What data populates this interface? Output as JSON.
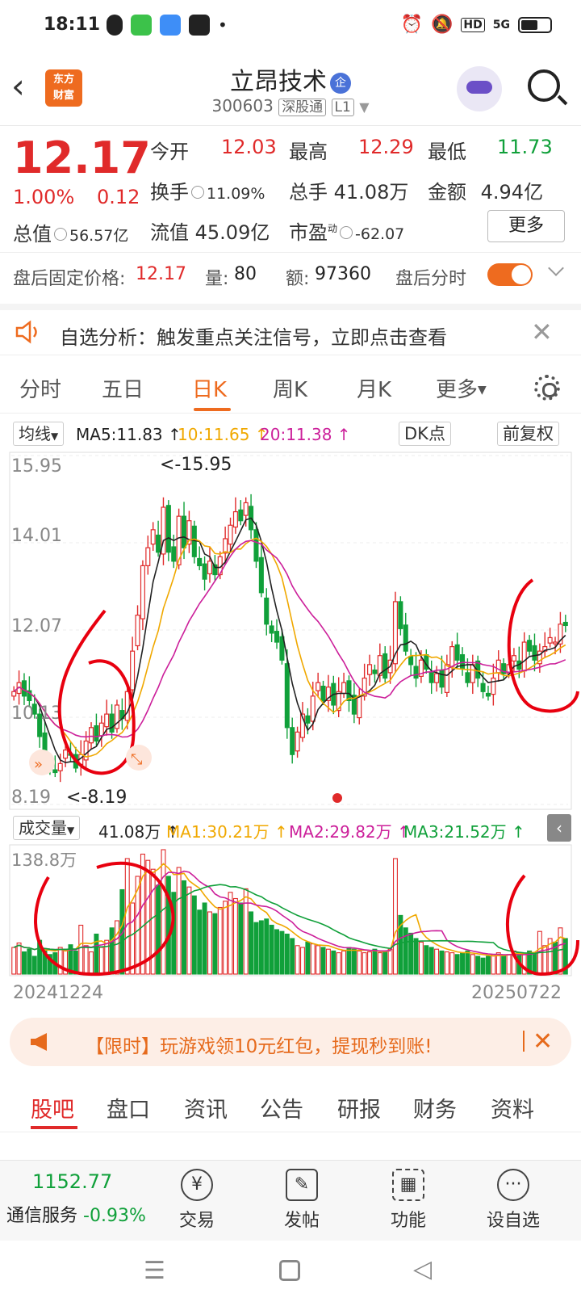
{
  "status": {
    "time": "18:11",
    "net_label": "HD",
    "signal_label": "5G"
  },
  "header": {
    "name": "立昂技术",
    "qi_badge": "企",
    "code": "300603",
    "tag1": "深股通",
    "tag2": "L1",
    "logo_line1": "东方",
    "logo_line2": "财富"
  },
  "quote": {
    "price": "12.17",
    "pct": "1.00%",
    "change": "0.12",
    "open_label": "今开",
    "open": "12.03",
    "high_label": "最高",
    "high": "12.29",
    "low_label": "最低",
    "low": "11.73",
    "turnover_label": "换手",
    "turnover": "11.09%",
    "volume_label": "总手",
    "volume": "41.08万",
    "amount_label": "金额",
    "amount": "4.94亿",
    "mktcap_label": "总值",
    "mktcap": "56.57亿",
    "float_label": "流值",
    "float": "45.09亿",
    "pe_label": "市盈",
    "pe_sup": "动",
    "pe": "-62.07",
    "more": "更多"
  },
  "afterhours": {
    "price_label": "盘后固定价格:",
    "price": "12.17",
    "vol_label": "量:",
    "vol": "80",
    "amt_label": "额:",
    "amt": "97360",
    "toggle_label": "盘后分时"
  },
  "alert": {
    "text": "自选分析：触发重点关注信号，立即点击查看"
  },
  "chart_tabs": [
    "分时",
    "五日",
    "日K",
    "周K",
    "月K",
    "更多"
  ],
  "ma_bar": {
    "select": "均线",
    "ma5": "MA5:11.83",
    "ma10": "10:11.65",
    "ma20": "20:11.38",
    "dk": "DK点",
    "adj": "前复权"
  },
  "vol_bar": {
    "select": "成交量",
    "vol": "41.08万",
    "ma1": "MA1:30.21万",
    "ma2": "MA2:29.82万",
    "ma3": "MA3:21.52万"
  },
  "chart_data": {
    "type": "candlestick",
    "y_ticks": [
      "15.95",
      "14.01",
      "12.07",
      "10.13",
      "8.19"
    ],
    "ylim": [
      8.19,
      15.95
    ],
    "max_label": "<-15.95",
    "min_label": "<-8.19",
    "vol_max_label": "138.8万",
    "start_date": "20241224",
    "end_date": "20250722",
    "colors": {
      "up": "#e02a2a",
      "down": "#10a03a",
      "ma5": "#222222",
      "ma10": "#f0a800",
      "ma20": "#cc1f9a",
      "vma3": "#10a03a"
    },
    "closes": [
      10.7,
      10.9,
      10.6,
      10.5,
      10.2,
      9.7,
      9.2,
      9.0,
      8.9,
      9.1,
      9.4,
      9.3,
      9.0,
      9.3,
      9.6,
      9.9,
      9.6,
      10.0,
      10.2,
      9.8,
      10.4,
      10.1,
      10.7,
      11.6,
      12.4,
      13.5,
      13.9,
      14.3,
      13.8,
      14.8,
      13.8,
      13.6,
      14.6,
      13.9,
      14.5,
      13.7,
      13.5,
      13.2,
      13.6,
      13.3,
      13.7,
      14.1,
      14.4,
      14.7,
      14.5,
      14.9,
      14.3,
      13.6,
      12.9,
      12.2,
      12.0,
      11.8,
      11.4,
      9.9,
      9.3,
      9.8,
      10.2,
      10.0,
      10.6,
      10.9,
      10.5,
      10.8,
      10.4,
      10.7,
      10.9,
      10.5,
      10.2,
      10.6,
      11.0,
      11.3,
      11.1,
      11.5,
      11.0,
      11.4,
      12.7,
      12.1,
      11.6,
      11.3,
      11.0,
      11.4,
      11.2,
      10.9,
      11.1,
      10.8,
      11.3,
      11.7,
      11.4,
      11.2,
      10.9,
      11.3,
      11.0,
      10.7,
      10.6,
      11.0,
      11.4,
      11.1,
      11.3,
      11.5,
      11.2,
      11.8,
      11.6,
      11.4,
      11.6,
      11.7,
      11.9,
      11.8,
      12.2,
      12.17
    ],
    "volumes": [
      30,
      35,
      25,
      28,
      20,
      38,
      26,
      22,
      24,
      30,
      28,
      33,
      26,
      55,
      32,
      25,
      45,
      30,
      38,
      52,
      60,
      95,
      130,
      80,
      110,
      135,
      128,
      118,
      100,
      140,
      110,
      92,
      120,
      105,
      98,
      88,
      72,
      80,
      70,
      68,
      75,
      82,
      92,
      85,
      80,
      96,
      70,
      58,
      60,
      62,
      55,
      50,
      48,
      45,
      40,
      32,
      30,
      36,
      34,
      32,
      30,
      28,
      26,
      24,
      26,
      30,
      28,
      26,
      24,
      25,
      28,
      24,
      26,
      28,
      130,
      66,
      52,
      46,
      40,
      36,
      32,
      30,
      28,
      26,
      25,
      24,
      22,
      24,
      26,
      22,
      20,
      18,
      20,
      22,
      24,
      20,
      22,
      26,
      24,
      22,
      26,
      24,
      48,
      32,
      40,
      36,
      52,
      40
    ]
  },
  "promo": {
    "text": "【限时】玩游戏领10元红包，提现秒到账!"
  },
  "bottom_tabs": [
    "股吧",
    "盘口",
    "资讯",
    "公告",
    "研报",
    "财务",
    "资料"
  ],
  "footer": {
    "index_value": "1152.77",
    "index_name": "通信服务",
    "index_change": "-0.93%",
    "items": [
      "交易",
      "发帖",
      "功能",
      "设自选"
    ]
  }
}
